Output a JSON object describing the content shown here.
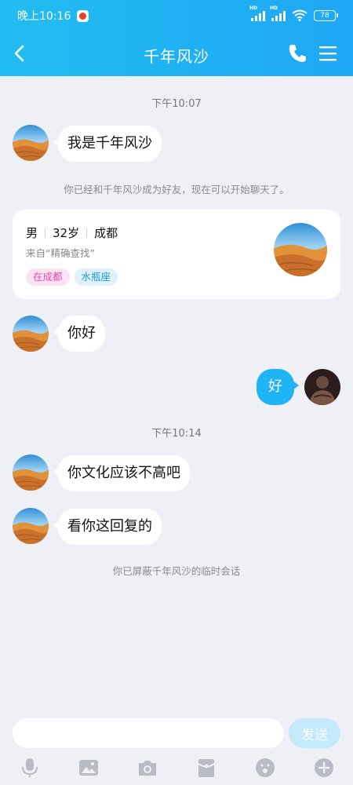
{
  "status_bar": {
    "time": "晚上10:16",
    "network_label": "HD",
    "battery": "78"
  },
  "header": {
    "title": "千年风沙"
  },
  "messages": {
    "timestamp_1": "下午10:07",
    "msg_1": "我是千年风沙",
    "friend_notice": "你已经和千年风沙成为好友，现在可以开始聊天了。",
    "msg_2": "你好",
    "msg_3_self": "好",
    "timestamp_2": "下午10:14",
    "msg_4": "你文化应该不高吧",
    "msg_5": "看你这回复的",
    "block_notice": "你已屏蔽千年风沙的临时会话"
  },
  "profile_card": {
    "gender": "男",
    "age": "32岁",
    "city": "成都",
    "source": "来自“精确查找”",
    "tags": [
      "在成都",
      "水瓶座"
    ]
  },
  "input_bar": {
    "placeholder": "",
    "send_label": "发送"
  },
  "icons": {
    "back": "chevron-left-icon",
    "phone": "phone-icon",
    "menu": "menu-icon",
    "toolbar": [
      "microphone-icon",
      "image-icon",
      "camera-icon",
      "red-packet-icon",
      "emoji-icon",
      "plus-icon"
    ]
  },
  "colors": {
    "header": "#22bdf0",
    "self_bubble": "#1fb4f3",
    "send_button": "#c3e9fa",
    "tag_pink": "#e34aa8",
    "tag_blue": "#1899d1"
  }
}
